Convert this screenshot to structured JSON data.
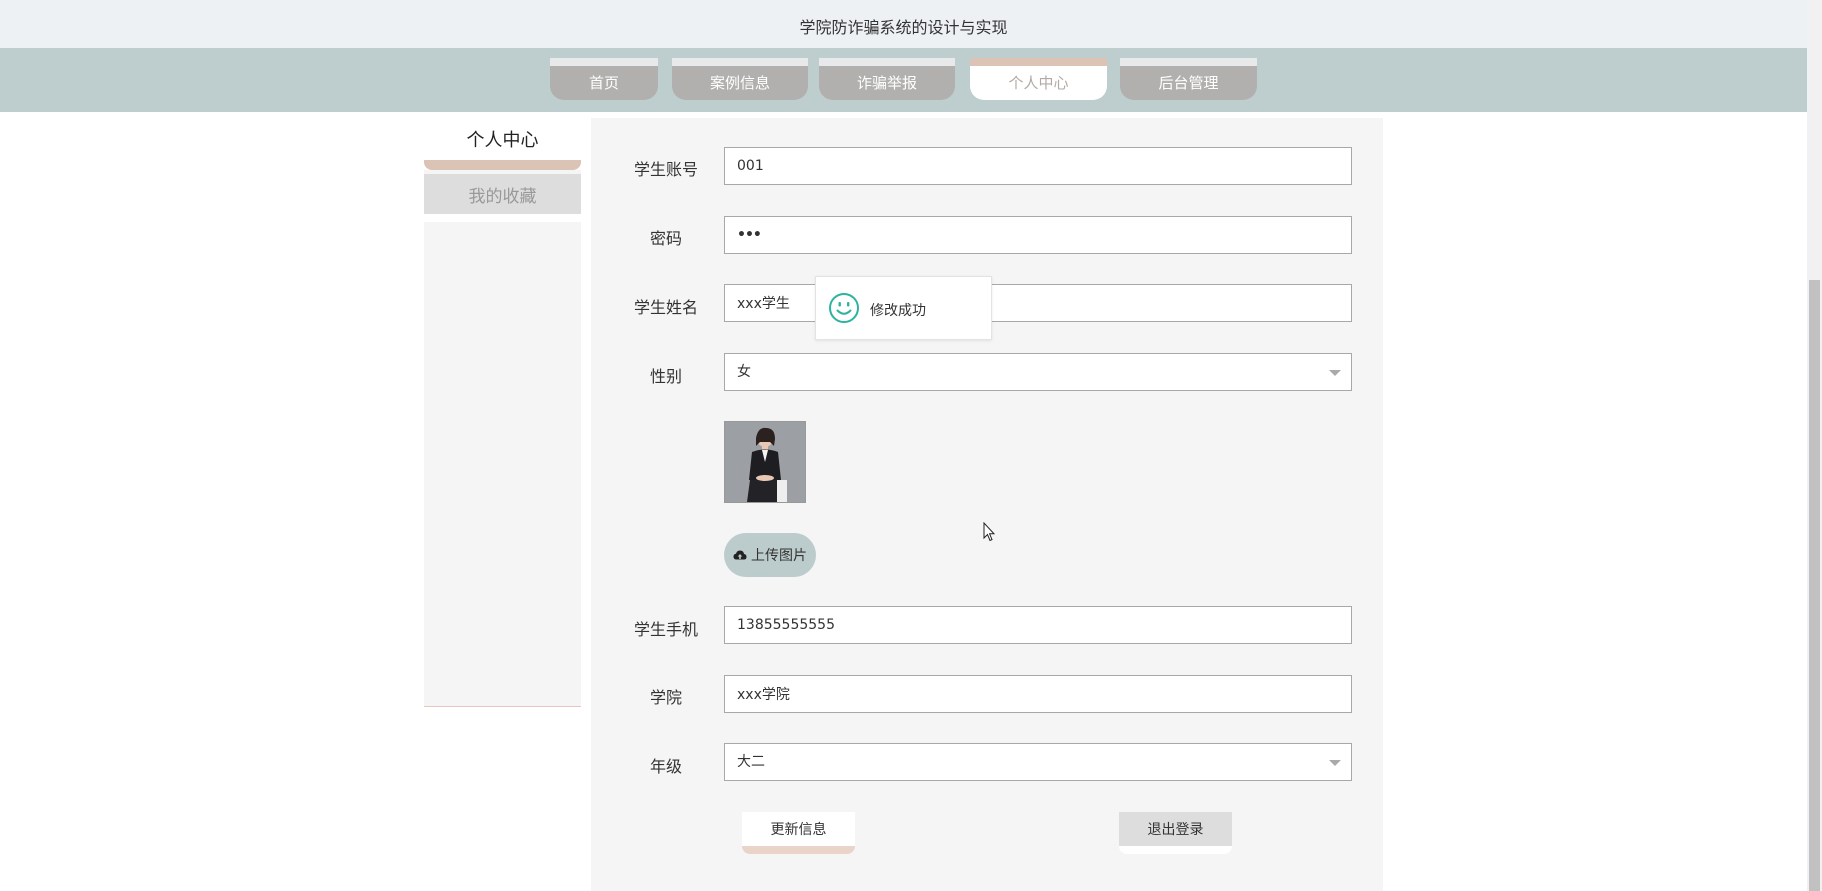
{
  "site_title": "学院防诈骗系统的设计与实现",
  "nav": {
    "tabs": [
      {
        "label": "首页"
      },
      {
        "label": "案例信息"
      },
      {
        "label": "诈骗举报"
      },
      {
        "label": "个人中心",
        "active": true
      },
      {
        "label": "后台管理"
      }
    ]
  },
  "sidebar": {
    "title": "个人中心",
    "items": [
      {
        "label": "我的收藏"
      }
    ]
  },
  "form": {
    "account_label": "学生账号",
    "account_value": "001",
    "password_label": "密码",
    "password_value": "•••",
    "name_label": "学生姓名",
    "name_value": "xxx学生",
    "gender_label": "性别",
    "gender_value": "女",
    "upload_label": "上传图片",
    "phone_label": "学生手机",
    "phone_value": "13855555555",
    "college_label": "学院",
    "college_value": "xxx学院",
    "grade_label": "年级",
    "grade_value": "大二"
  },
  "buttons": {
    "update_label": "更新信息",
    "logout_label": "退出登录"
  },
  "toast": {
    "message": "修改成功",
    "icon": "smile-icon"
  },
  "colors": {
    "nav_band": "#becdcd",
    "tab_inactive": "#b1b0ae",
    "accent": "#dbc3b5",
    "toast_icon": "#2db39e"
  }
}
